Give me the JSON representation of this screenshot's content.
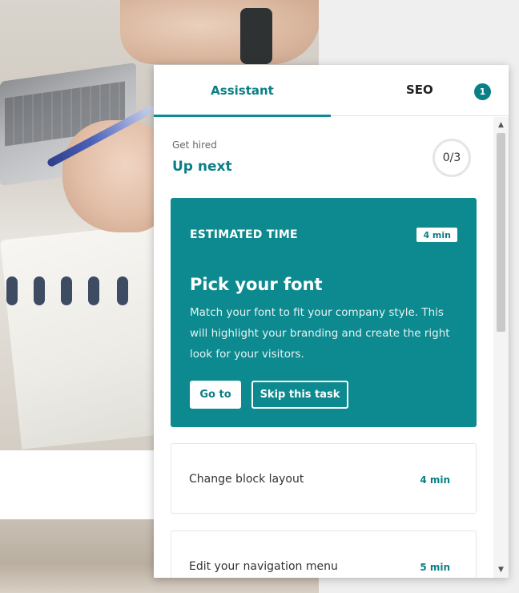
{
  "tabs": [
    {
      "label": "Assistant",
      "active": true
    },
    {
      "label": "SEO",
      "badge": "1"
    }
  ],
  "header": {
    "eyebrow": "Get hired",
    "title": "Up next",
    "progress": "0/3"
  },
  "current_task": {
    "eyebrow": "ESTIMATED TIME",
    "time": "4 min",
    "title": "Pick your font",
    "description": "Match your font to fit your company style. This will highlight your branding and create the right look for your visitors.",
    "primary_label": "Go to",
    "secondary_label": "Skip this task"
  },
  "tasks": [
    {
      "name": "Change block layout",
      "time": "4 min"
    },
    {
      "name": "Edit your navigation menu",
      "time": "5 min"
    }
  ],
  "colors": {
    "accent": "#0a7f86",
    "card_bg": "#0c8a8f"
  },
  "icons": {
    "scroll_up": "chevron-up-icon",
    "scroll_down": "chevron-down-icon"
  }
}
